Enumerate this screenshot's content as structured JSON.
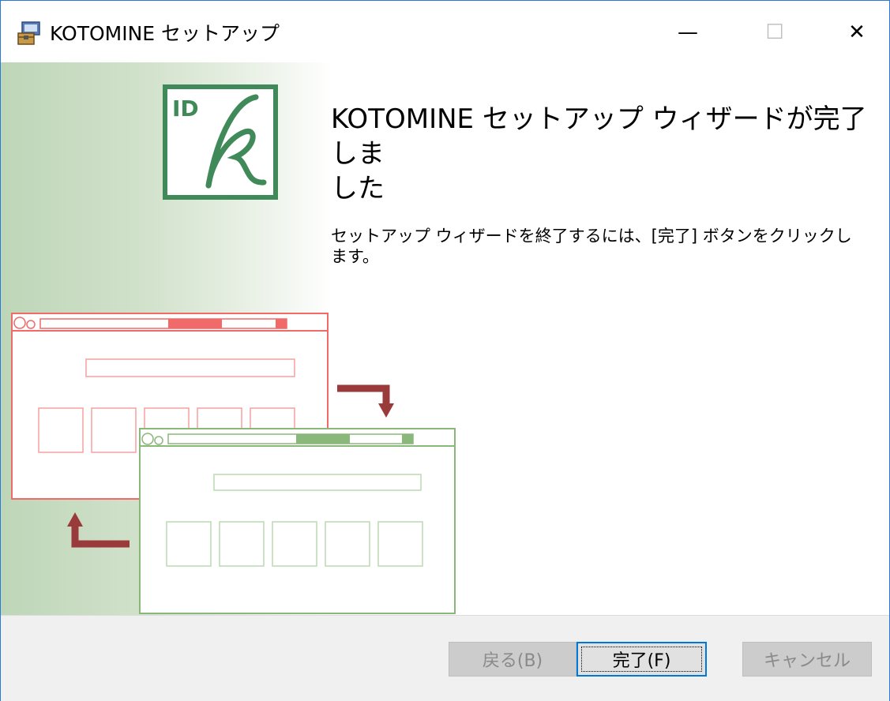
{
  "window": {
    "title": "KOTOMINE セットアップ",
    "controls": {
      "minimize": "—",
      "maximize": "☐",
      "close": "✕"
    }
  },
  "main": {
    "heading_line1": "KOTOMINE セットアップ ウィザードが完了しま",
    "heading_line2": "した",
    "description_line1": "セットアップ ウィザードを終了するには、[完了] ボタンをクリックし",
    "description_line2": "ます。",
    "logo_text": "ID"
  },
  "buttons": {
    "back": "戻る(B)",
    "finish": "完了(F)",
    "cancel": "キャンセル"
  },
  "colors": {
    "accent": "#0078d7",
    "logo_green": "#3f8a58",
    "red_window": "#f06a6a",
    "green_window": "#8ab87a",
    "arrow": "#9b3a3a"
  },
  "icons": [
    "installer-icon",
    "minimize-icon",
    "maximize-icon",
    "close-icon"
  ]
}
